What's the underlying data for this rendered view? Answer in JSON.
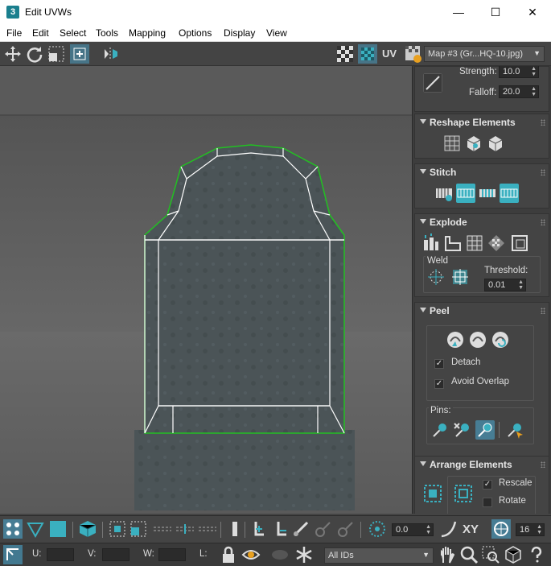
{
  "window": {
    "title": "Edit UVWs",
    "app_icon": "3",
    "minimize": "—",
    "maximize": "☐",
    "close": "✕"
  },
  "menu": [
    "File",
    "Edit",
    "Select",
    "Tools",
    "Mapping",
    "Options",
    "Display",
    "View"
  ],
  "toolbar": {
    "uv_label": "UV",
    "map_select": "Map #3 (Gr...HQ-10.jpg)"
  },
  "soft_select": {
    "strength_label": "Strength:",
    "strength_value": "10.0",
    "falloff_label": "Falloff:",
    "falloff_value": "20.0"
  },
  "rollouts": {
    "reshape": "Reshape Elements",
    "stitch": "Stitch",
    "explode": "Explode",
    "weld_label": "Weld",
    "threshold_label": "Threshold:",
    "threshold_value": "0.01",
    "peel": "Peel",
    "detach_label": "Detach",
    "avoid_overlap_label": "Avoid Overlap",
    "pins_label": "Pins:",
    "arrange": "Arrange Elements",
    "rescale_label": "Rescale",
    "rotate_label": "Rotate"
  },
  "bottom": {
    "angle_value": "0.0",
    "xy_label": "XY",
    "grid_value": "16",
    "u_label": "U:",
    "v_label": "V:",
    "w_label": "W:",
    "l_label": "L:",
    "ids_select": "All IDs"
  },
  "colors": {
    "accent": "#3ab0c0",
    "panel_bg": "#444444",
    "uv_green": "#22c022",
    "uv_white": "#ffffff"
  }
}
